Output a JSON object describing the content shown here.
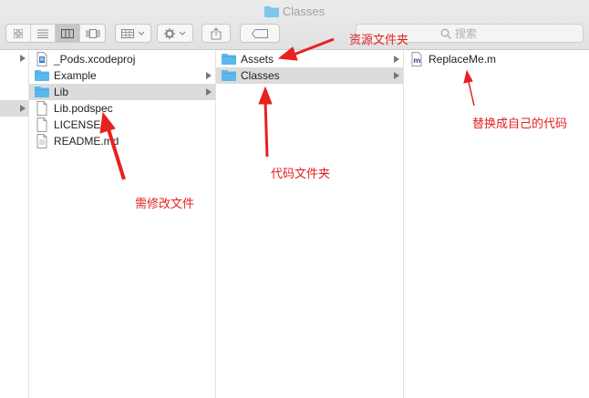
{
  "window": {
    "title": "Classes"
  },
  "toolbar": {
    "search_placeholder": "搜索"
  },
  "column1": [
    {
      "name": "_Pods.xcodeproj",
      "icon": "xcodeproj-icon",
      "is_folder": false,
      "selected": false
    },
    {
      "name": "Example",
      "icon": "folder-icon",
      "is_folder": true,
      "selected": false
    },
    {
      "name": "Lib",
      "icon": "folder-icon",
      "is_folder": true,
      "selected": true
    },
    {
      "name": "Lib.podspec",
      "icon": "document-icon",
      "is_folder": false,
      "selected": false
    },
    {
      "name": "LICENSE",
      "icon": "document-icon",
      "is_folder": false,
      "selected": false
    },
    {
      "name": "README.md",
      "icon": "document-icon",
      "is_folder": false,
      "selected": false
    }
  ],
  "column2": [
    {
      "name": "Assets",
      "icon": "folder-icon",
      "is_folder": true,
      "selected": false
    },
    {
      "name": "Classes",
      "icon": "folder-icon",
      "is_folder": true,
      "selected": true
    }
  ],
  "column3": [
    {
      "name": "ReplaceMe.m",
      "icon": "objc-source-icon",
      "is_folder": false,
      "selected": false
    }
  ],
  "annotations": {
    "resource_folder": "资源文件夹",
    "code_folder": "代码文件夹",
    "replace_own_code": "替换成自己的代码",
    "must_edit_file": "需修改文件"
  },
  "colors": {
    "annotation": "#e02020",
    "folder": "#5ab8ec",
    "selection": "#dcdcdc"
  }
}
